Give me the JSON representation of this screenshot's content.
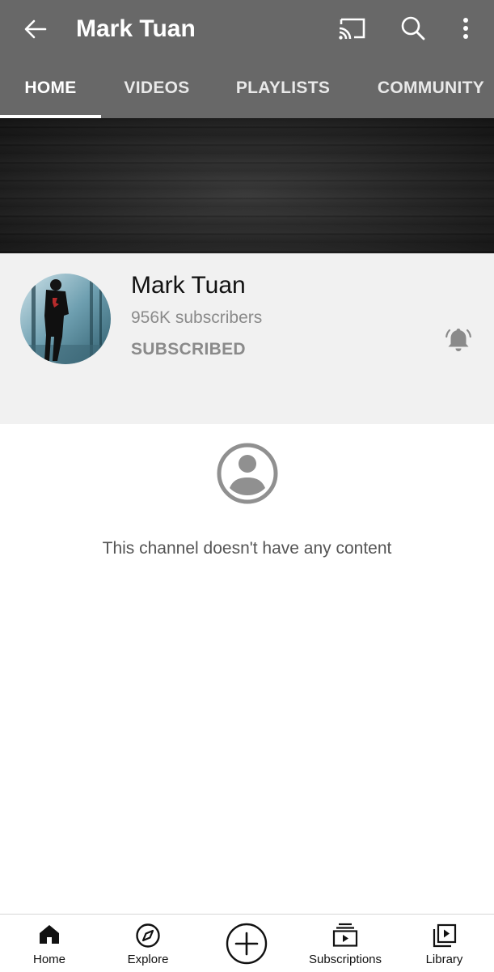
{
  "appbar": {
    "title": "Mark Tuan",
    "icons": [
      "back-arrow-icon",
      "cast-icon",
      "search-icon",
      "more-vert-icon"
    ]
  },
  "tabs": [
    {
      "label": "HOME",
      "active": true
    },
    {
      "label": "VIDEOS",
      "active": false
    },
    {
      "label": "PLAYLISTS",
      "active": false
    },
    {
      "label": "COMMUNITY",
      "active": false
    }
  ],
  "channel": {
    "name": "Mark Tuan",
    "subscribers": "956K subscribers",
    "subscribe_state": "SUBSCRIBED",
    "notification_icon": "bell-icon"
  },
  "empty_state": {
    "icon": "account-circle-icon",
    "message": "This channel doesn't have any content"
  },
  "bottom_nav": [
    {
      "label": "Home",
      "icon": "home-icon",
      "active": true
    },
    {
      "label": "Explore",
      "icon": "explore-compass-icon",
      "active": false
    },
    {
      "label": "",
      "icon": "create-plus-icon",
      "active": false
    },
    {
      "label": "Subscriptions",
      "icon": "subscriptions-icon",
      "active": false
    },
    {
      "label": "Library",
      "icon": "library-icon",
      "active": false
    }
  ],
  "colors": {
    "appbar": "#686868",
    "header_bg": "#f1f1f1",
    "muted_text": "#8a8a8a"
  }
}
